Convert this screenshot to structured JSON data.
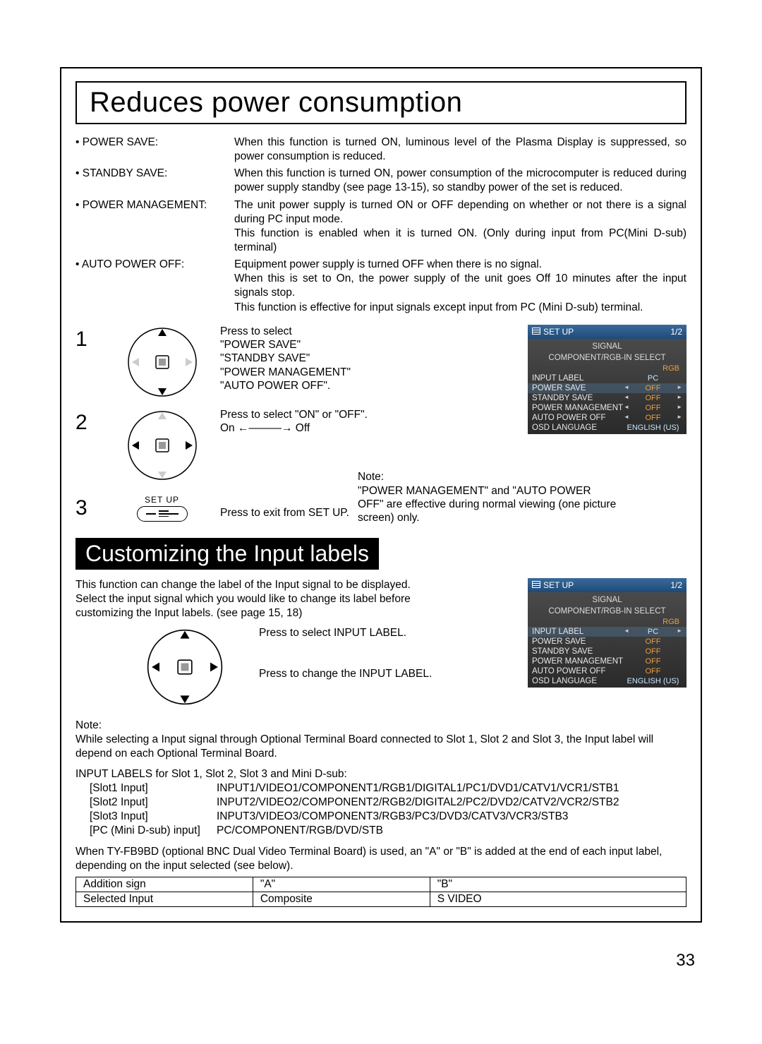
{
  "title1": "Reduces power consumption",
  "defs": {
    "power_save": {
      "label": "• POWER SAVE:",
      "text": "When this function is turned ON, luminous level of the Plasma Display is suppressed, so power consumption is reduced."
    },
    "standby_save": {
      "label": "• STANDBY SAVE:",
      "text": "When this function is turned ON, power consumption of the microcomputer is reduced during power supply standby (see page 13-15), so standby power of the set is reduced."
    },
    "power_mgmt": {
      "label": "• POWER MANAGEMENT:",
      "text": "The unit power supply is turned ON or OFF depending on whether or not there is a signal during PC input mode.\nThis function is enabled when it is turned ON. (Only during input from PC(Mini D-sub) terminal)"
    },
    "auto_off": {
      "label": "• AUTO POWER OFF:",
      "text": "Equipment power supply is turned OFF when there is no signal.\nWhen this is set to On, the power supply of the unit goes Off 10 minutes after the input signals stop.\nThis function is effective for input signals except input from PC (Mini D-sub) terminal."
    }
  },
  "steps": {
    "s1": {
      "num": "1",
      "text": "Press to select\n\"POWER SAVE\"\n\"STANDBY SAVE\"\n\"POWER MANAGEMENT\"\n\"AUTO POWER OFF\"."
    },
    "s2": {
      "num": "2",
      "text": "Press to select \"ON\" or \"OFF\".",
      "arrow": "On ←———→ Off"
    },
    "s3": {
      "num": "3",
      "btn": "SET UP",
      "text": "Press to exit from SET UP."
    }
  },
  "menu1": {
    "title": "SET UP",
    "page": "1/2",
    "signal": "SIGNAL",
    "comp": "COMPONENT/RGB-IN SELECT",
    "rgb": "RGB",
    "rows": [
      {
        "l": "INPUT LABEL",
        "v": "PC",
        "cls": "pc"
      },
      {
        "l": "POWER SAVE",
        "v": "OFF",
        "cls": "orange",
        "spin": true,
        "hl": true
      },
      {
        "l": "STANDBY SAVE",
        "v": "OFF",
        "cls": "orange",
        "spin": true
      },
      {
        "l": "POWER MANAGEMENT",
        "v": "OFF",
        "cls": "orange",
        "spin": true
      },
      {
        "l": "AUTO POWER OFF",
        "v": "OFF",
        "cls": "orange",
        "spin": true
      },
      {
        "l": "OSD LANGUAGE",
        "v": "ENGLISH (US)",
        "cls": "pc"
      }
    ]
  },
  "note_right": {
    "head": "Note:",
    "text": "\"POWER MANAGEMENT\" and \"AUTO POWER OFF\" are effective during normal viewing (one picture screen) only."
  },
  "title2": "Customizing the Input labels",
  "intro": "This function can change the label of the Input signal to be displayed.\nSelect the input signal which you would like to change its label before customizing the Input labels. (see page 15, 18)",
  "custom": {
    "l1": "Press to select INPUT LABEL.",
    "l2": "Press to change the INPUT LABEL."
  },
  "menu2": {
    "title": "SET UP",
    "page": "1/2",
    "signal": "SIGNAL",
    "comp": "COMPONENT/RGB-IN SELECT",
    "rgb": "RGB",
    "rows": [
      {
        "l": "INPUT LABEL",
        "v": "PC",
        "cls": "pc",
        "spin": true,
        "hl": true
      },
      {
        "l": "POWER SAVE",
        "v": "OFF",
        "cls": "orange"
      },
      {
        "l": "STANDBY SAVE",
        "v": "OFF",
        "cls": "orange"
      },
      {
        "l": "POWER MANAGEMENT",
        "v": "OFF",
        "cls": "orange"
      },
      {
        "l": "AUTO POWER OFF",
        "v": "OFF",
        "cls": "orange"
      },
      {
        "l": "OSD LANGUAGE",
        "v": "ENGLISH (US)",
        "cls": "pc"
      }
    ]
  },
  "note2": {
    "head": "Note:",
    "text": "While selecting a Input signal through Optional Terminal Board connected to Slot 1, Slot 2 and Slot 3, the Input label will depend on each Optional Terminal Board."
  },
  "slots": {
    "head": "INPUT LABELS for Slot 1, Slot 2, Slot 3 and Mini D-sub:",
    "rows": [
      {
        "l": "[Slot1 Input]",
        "v": "INPUT1/VIDEO1/COMPONENT1/RGB1/DIGITAL1/PC1/DVD1/CATV1/VCR1/STB1"
      },
      {
        "l": "[Slot2 Input]",
        "v": "INPUT2/VIDEO2/COMPONENT2/RGB2/DIGITAL2/PC2/DVD2/CATV2/VCR2/STB2"
      },
      {
        "l": "[Slot3 Input]",
        "v": "INPUT3/VIDEO3/COMPONENT3/RGB3/PC3/DVD3/CATV3/VCR3/STB3"
      },
      {
        "l": "[PC (Mini D-sub) input]",
        "v": "PC/COMPONENT/RGB/DVD/STB"
      }
    ]
  },
  "bnc": "When TY-FB9BD (optional BNC Dual Video Terminal Board) is used, an \"A\" or \"B\" is added at the end of each input label, depending on the input selected (see below).",
  "table": {
    "r1": [
      "Addition sign",
      "\"A\"",
      "\"B\""
    ],
    "r2": [
      "Selected Input",
      "Composite",
      "S VIDEO"
    ]
  },
  "pagenum": "33"
}
